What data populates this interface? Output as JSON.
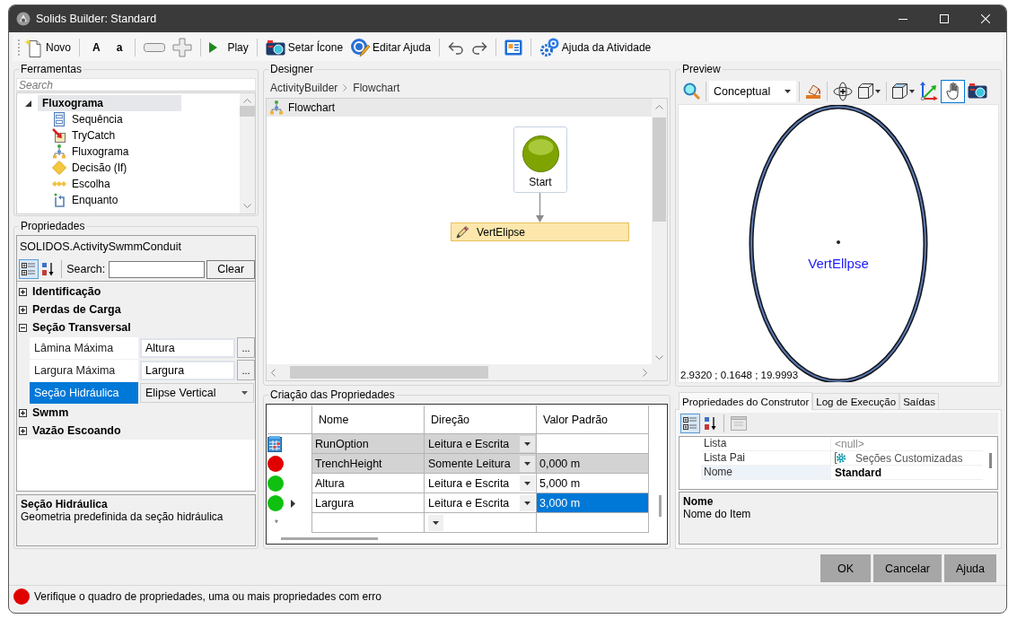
{
  "window": {
    "title": "Solids Builder: Standard"
  },
  "toolbar": {
    "new": "Novo",
    "font_larger": "A",
    "font_smaller": "a",
    "play": "Play",
    "set_icon": "Setar Ícone",
    "edit_help": "Editar Ajuda",
    "activity_help": "Ajuda da Atividade"
  },
  "tools": {
    "title": "Ferramentas",
    "search": {
      "placeholder": "Search"
    },
    "tree": [
      {
        "label": "Fluxograma",
        "expanded": true,
        "selected": true,
        "children": [
          {
            "label": "Sequência",
            "kind": "sequence",
            "selected": false
          },
          {
            "label": "TryCatch",
            "kind": "trycatch",
            "selected": false
          },
          {
            "label": "Fluxograma",
            "kind": "flowchart",
            "selected": false
          },
          {
            "label": "Decisão (If)",
            "kind": "decision",
            "selected": false
          },
          {
            "label": "Escolha",
            "kind": "switch",
            "selected": false
          },
          {
            "label": "Enquanto",
            "kind": "loop",
            "selected": false
          }
        ]
      }
    ]
  },
  "properties": {
    "title": "Propriedades",
    "object": "SOLIDOS.ActivitySwmmConduit",
    "categorized": true,
    "search_label": "Search:",
    "clear": "Clear",
    "categories": [
      {
        "label": "Identificação",
        "expanded": false,
        "selected": false
      },
      {
        "label": "Perdas de Carga",
        "expanded": false,
        "selected": false
      },
      {
        "label": "Seção Transversal",
        "expanded": true,
        "selected": false,
        "rows": [
          {
            "name": "Lâmina Máxima",
            "value": "Altura",
            "kind": "ellipsis",
            "button": "...",
            "selected": false
          },
          {
            "name": "Largura Máxima",
            "value": "Largura",
            "kind": "ellipsis",
            "button": "...",
            "selected": false
          },
          {
            "name": "Seção Hidráulica",
            "value": "Elipse Vertical",
            "kind": "dropdown",
            "selected": true
          }
        ]
      },
      {
        "label": "Swmm",
        "expanded": false,
        "selected": false
      },
      {
        "label": "Vazão Escoando",
        "expanded": false,
        "selected": false
      }
    ],
    "description": {
      "title": "Seção Hidráulica",
      "text": "Geometria predefinida da seção hidráulica"
    }
  },
  "designer": {
    "title": "Designer",
    "breadcrumb": [
      "ActivityBuilder",
      "Flowchart"
    ],
    "header": "Flowchart",
    "start": "Start",
    "activity": "VertElipse"
  },
  "property_creation": {
    "title": "Criação das Propriedades",
    "columns": [
      "Nome",
      "Direção",
      "Valor Padrão"
    ],
    "rows": [
      {
        "kind": "option",
        "name": "RunOption",
        "direction": "Leitura e Escrita",
        "disabled": true,
        "selected": false
      },
      {
        "kind": "status",
        "color": "#e00000",
        "name": "TrenchHeight",
        "direction": "Somente Leitura",
        "value": "0,000 m",
        "disabled": true,
        "selected": false
      },
      {
        "kind": "status",
        "color": "#10c010",
        "name": "Altura",
        "direction": "Leitura e Escrita",
        "value": "5,000 m",
        "disabled": false,
        "selected": false
      },
      {
        "kind": "status",
        "color": "#10c010",
        "name": "Largura",
        "direction": "Leitura e Escrita",
        "value": "3,000 m",
        "disabled": false,
        "selected": true
      }
    ],
    "new_row": "*"
  },
  "preview": {
    "title": "Preview",
    "visual_style": "Conceptual",
    "pan_active": true,
    "shape_label": "VertEllpse",
    "coordinates": "2.9320 ; 0.1648 ; 19.9993"
  },
  "builder": {
    "tabs": [
      {
        "label": "Propriedades do Construtor",
        "selected": true
      },
      {
        "label": "Log de Execução",
        "selected": false
      },
      {
        "label": "Saídas",
        "selected": false
      }
    ],
    "categorized": true,
    "rows": [
      {
        "name": "Lista",
        "value": "<null>",
        "kind": "null",
        "selected": false,
        "modified": false
      },
      {
        "name": "Lista Pai",
        "value": "Seções Customizadas",
        "kind": "reference",
        "selected": false,
        "modified": false
      },
      {
        "name": "Nome",
        "value": "Standard",
        "kind": "value",
        "selected": true,
        "modified": true
      }
    ],
    "description": {
      "title": "Nome",
      "text": "Nome do Item"
    }
  },
  "buttons": [
    "OK",
    "Cancelar",
    "Ajuda"
  ],
  "status_bar": {
    "error": true,
    "message": "Verifique o quadro de propriedades, uma ou mais propriedades com erro"
  }
}
